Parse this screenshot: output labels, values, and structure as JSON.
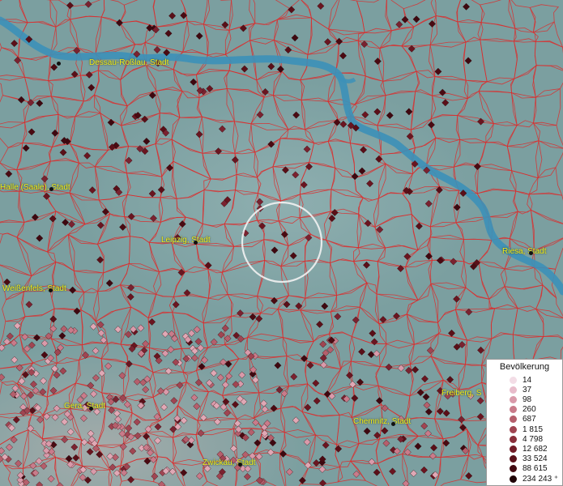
{
  "map": {
    "river_color": "#3c90b8",
    "border_color": "#dd2a2a",
    "label_color": "#f2ef1a",
    "selection_circle_color": "#f2f2f2"
  },
  "cities": [
    {
      "id": "dessau",
      "label": "Dessau-Roßlau, Stadt"
    },
    {
      "id": "halle",
      "label": "Halle (Saale), Stadt"
    },
    {
      "id": "leipzig",
      "label": "Leipzig, Stadt"
    },
    {
      "id": "weissenfels",
      "label": "Weißenfels, Stadt"
    },
    {
      "id": "riesa",
      "label": "Riesa, Stadt"
    },
    {
      "id": "freiberg",
      "label": "Freiberg, S"
    },
    {
      "id": "gera",
      "label": "Gera, Stadt"
    },
    {
      "id": "chemnitz",
      "label": "Chemnitz, Stadt"
    },
    {
      "id": "zwickau",
      "label": "Zwickau, Stadt"
    }
  ],
  "legend": {
    "title": "Bevölkerung",
    "items": [
      {
        "label": "14",
        "color": "#f3dde6"
      },
      {
        "label": "37",
        "color": "#e8bccb"
      },
      {
        "label": "98",
        "color": "#d99aaa"
      },
      {
        "label": "260",
        "color": "#c97b8a"
      },
      {
        "label": "687",
        "color": "#b55f6c"
      },
      {
        "label": "1 815",
        "color": "#a04552"
      },
      {
        "label": "4 798",
        "color": "#8a2f3b"
      },
      {
        "label": "12 682",
        "color": "#731d28"
      },
      {
        "label": "33 524",
        "color": "#5b121b"
      },
      {
        "label": "88 615",
        "color": "#420a11"
      },
      {
        "label": "234 243 ⁺",
        "color": "#1f0306"
      }
    ]
  }
}
